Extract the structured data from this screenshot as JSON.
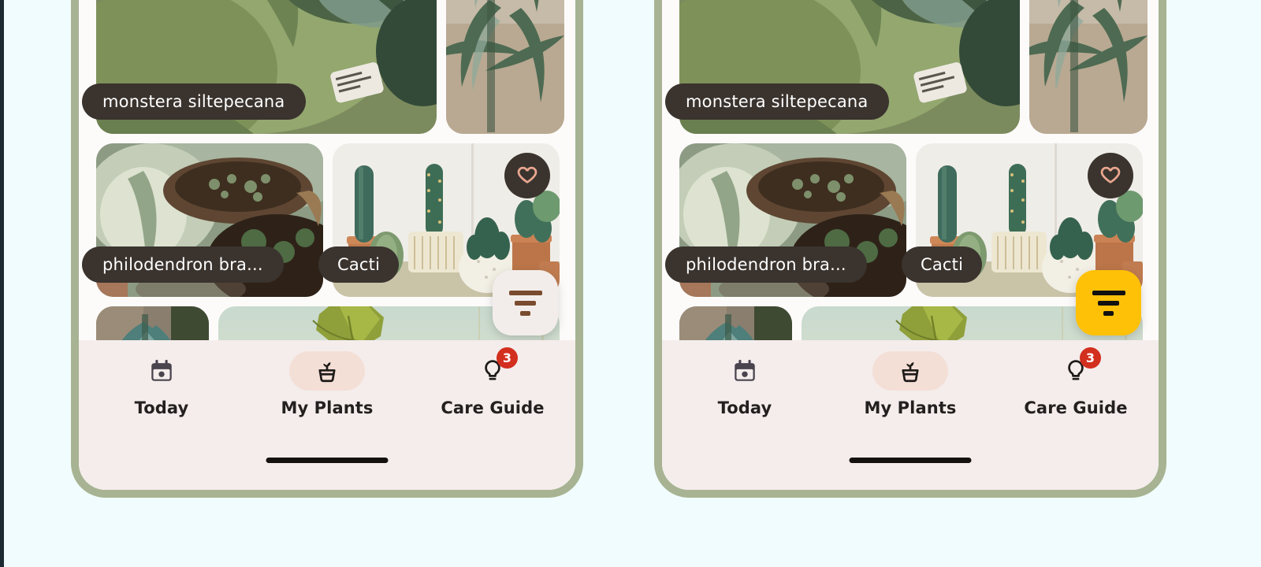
{
  "theme": {
    "background": "#F0FCFD",
    "phone_frame": "#A7B392",
    "screen_bg": "#FDFBFA",
    "chip_bg": "#3A332E",
    "chip_text": "#FFFFFF",
    "nav_bg": "#F4EDEC",
    "nav_active_pill": "#F4DFD6",
    "badge_red": "#D32F1E",
    "heart_pink": "#E9A68F",
    "fab_left_bg": "#F2EDEA",
    "fab_left_icon": "#7A4B2E",
    "fab_right_bg": "#FFC107",
    "fab_right_icon": "#111111"
  },
  "phones": [
    {
      "id": "phone-left",
      "fab": {
        "name": "filter-button",
        "icon": "filter-icon",
        "bg": "#F2EDEA",
        "icon_color": "#7A4B2E"
      }
    },
    {
      "id": "phone-right",
      "fab": {
        "name": "filter-button",
        "icon": "filter-icon",
        "bg": "#FFC107",
        "icon_color": "#111111"
      }
    }
  ],
  "plant_grid": {
    "rows": [
      {
        "cards": [
          {
            "label": "monstera siltepecana",
            "favorite": false,
            "image": "monstera-photo"
          },
          {
            "label": "",
            "favorite": false,
            "image": "palm-photo"
          }
        ]
      },
      {
        "cards": [
          {
            "label": "philodendron bra...",
            "favorite": false,
            "image": "philodendron-photo"
          },
          {
            "label": "Cacti",
            "favorite": true,
            "image": "cacti-photo"
          }
        ]
      },
      {
        "cards": [
          {
            "label": "",
            "favorite": false,
            "image": "blue-palm-photo"
          },
          {
            "label": "",
            "favorite": false,
            "image": "yellow-leaves-photo"
          }
        ]
      }
    ]
  },
  "bottom_nav": {
    "items": [
      {
        "label": "Today",
        "icon": "calendar-icon",
        "active": false,
        "badge": null
      },
      {
        "label": "My Plants",
        "icon": "plant-pot-icon",
        "active": true,
        "badge": null
      },
      {
        "label": "Care Guide",
        "icon": "lightbulb-icon",
        "active": false,
        "badge": "3"
      }
    ]
  }
}
